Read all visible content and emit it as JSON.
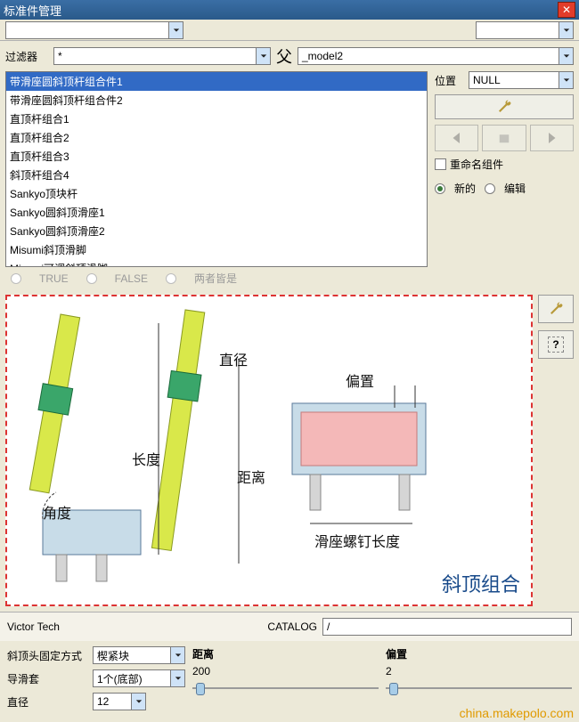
{
  "window": {
    "title": "标准件管理"
  },
  "filter": {
    "label": "过滤器",
    "value": "*",
    "parent_label": "父",
    "parent_value": "_model2"
  },
  "list": {
    "items": [
      "带滑座圆斜顶杆组合件1",
      "带滑座圆斜顶杆组合件2",
      "直顶杆组合1",
      "直顶杆组合2",
      "直顶杆组合3",
      "斜顶杆组合4",
      "Sankyo顶块杆",
      "Sankyo圆斜顶滑座1",
      "Sankyo圆斜顶滑座2",
      "Misumi斜顶滑脚",
      "Misumi可调斜顶滑脚"
    ],
    "selected": 0
  },
  "position": {
    "label": "位置",
    "value": "NULL"
  },
  "options": {
    "rename_label": "重命名组件",
    "new_label": "新的",
    "edit_label": "编辑",
    "selected": "new"
  },
  "tri_options": {
    "true_label": "TRUE",
    "false_label": "FALSE",
    "both_label": "两者皆是"
  },
  "preview": {
    "title": "斜顶组合",
    "labels": {
      "diameter": "直径",
      "length": "长度",
      "distance": "距离",
      "angle": "角度",
      "offset": "偏置",
      "screw_length": "滑座螺钉长度"
    }
  },
  "vendor": {
    "name": "Victor Tech",
    "catalog_label": "CATALOG",
    "catalog_value": "/"
  },
  "params": {
    "fix_mode": {
      "label": "斜顶头固定方式",
      "value": "楔紧块"
    },
    "guide": {
      "label": "导滑套",
      "value": "1个(底部)"
    },
    "diameter": {
      "label": "直径",
      "value": "12"
    },
    "distance": {
      "label": "距离",
      "value": "200"
    },
    "offset": {
      "label": "偏置",
      "value": "2"
    }
  },
  "footer": {
    "text": "china.makepolo.com"
  },
  "icons": {
    "wrench": "wrench-icon",
    "help": "help-icon",
    "close": "close-icon",
    "dropdown": "chevron-down-icon"
  }
}
